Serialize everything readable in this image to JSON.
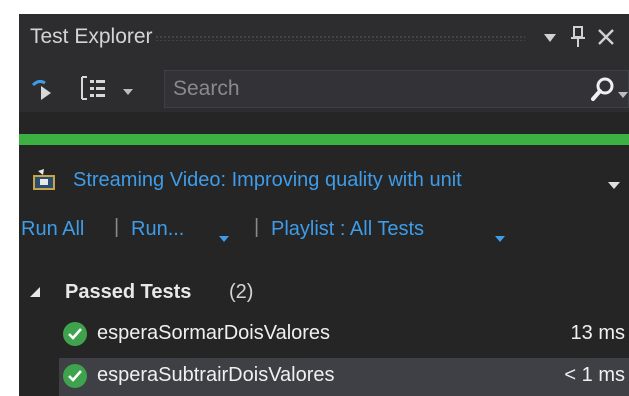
{
  "window": {
    "title": "Test Explorer",
    "icons": [
      "dropdown-arrow-icon",
      "pin-icon",
      "close-icon"
    ]
  },
  "toolbar": {
    "icons": [
      "run-settings-icon",
      "group-by-icon",
      "chevron-down-icon",
      "search-icon"
    ],
    "search": {
      "placeholder": "Search",
      "value": ""
    }
  },
  "progress": {
    "value": 1.0,
    "color": "#3cb043"
  },
  "playlist": {
    "name": "Streaming Video: Improving quality with unit",
    "icon": "project-icon"
  },
  "commands": {
    "run_all": "Run All",
    "run": "Run...",
    "playlist": "Playlist : All Tests"
  },
  "groups": [
    {
      "label": "Passed Tests",
      "count": "(2)",
      "tests": [
        {
          "name": "esperaSormarDoisValores",
          "duration": "13 ms",
          "status": "passed"
        },
        {
          "name": "esperaSubtrairDoisValores",
          "duration": "< 1 ms",
          "status": "passed"
        }
      ]
    }
  ],
  "colors": {
    "panel": "#252526",
    "accent_link": "#3e9ce8",
    "pass": "#3fa34d"
  }
}
